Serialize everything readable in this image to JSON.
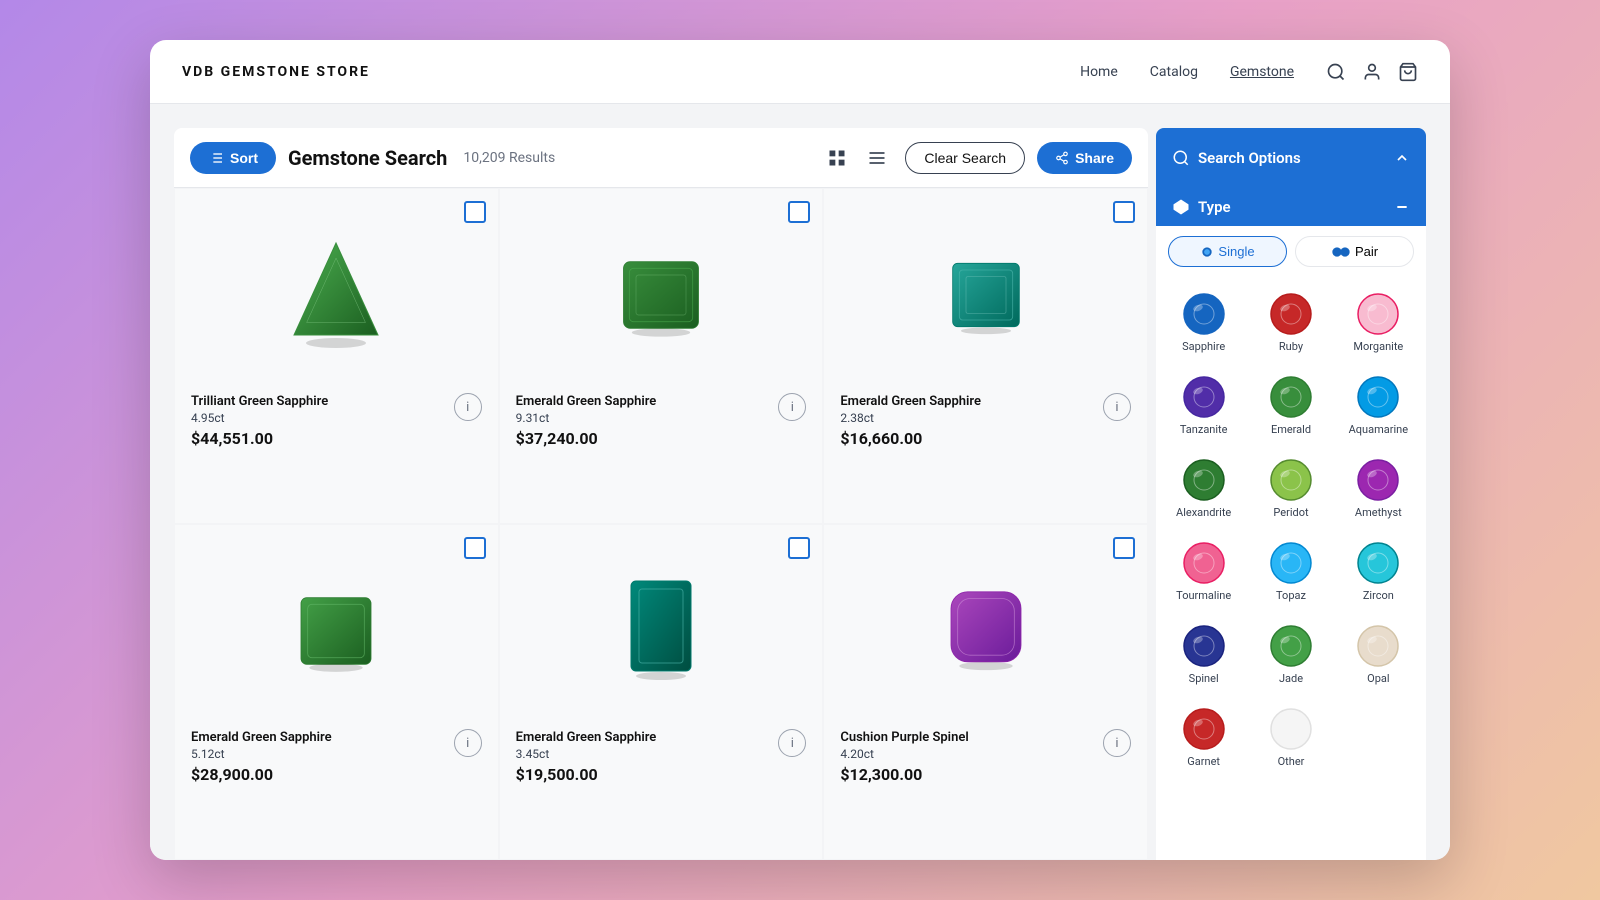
{
  "nav": {
    "logo": "VDB GEMSTONE STORE",
    "links": [
      {
        "label": "Home",
        "active": false
      },
      {
        "label": "Catalog",
        "active": false
      },
      {
        "label": "Gemstone",
        "active": true
      }
    ]
  },
  "toolbar": {
    "sort_label": "Sort",
    "search_title": "Gemstone Search",
    "result_count": "10,209 Results",
    "clear_label": "Clear Search",
    "share_label": "Share"
  },
  "products": [
    {
      "name": "Trilliant Green Sapphire",
      "carat": "4.95ct",
      "price": "$44,551.00",
      "shape": "trilliant",
      "color": "#2e7d32"
    },
    {
      "name": "Emerald Green Sapphire",
      "carat": "9.31ct",
      "price": "$37,240.00",
      "shape": "emerald",
      "color": "#1b5e20"
    },
    {
      "name": "Emerald Green Sapphire",
      "carat": "2.38ct",
      "price": "$16,660.00",
      "shape": "emerald",
      "color": "#00695c"
    },
    {
      "name": "Emerald Green Sapphire",
      "carat": "5.12ct",
      "price": "$28,900.00",
      "shape": "emerald2",
      "color": "#2e7d32"
    },
    {
      "name": "Emerald Green Sapphire",
      "carat": "3.45ct",
      "price": "$19,500.00",
      "shape": "emerald3",
      "color": "#00897b"
    },
    {
      "name": "Cushion Purple Spinel",
      "carat": "4.20ct",
      "price": "$12,300.00",
      "shape": "cushion",
      "color": "#7b1fa2"
    }
  ],
  "search_options": {
    "label": "Search Options",
    "type_section": "Type",
    "single_label": "Single",
    "pair_label": "Pair",
    "gems": [
      {
        "name": "Sapphire",
        "color": "#1565c0",
        "bg": "#1565c0"
      },
      {
        "name": "Ruby",
        "color": "#b71c1c",
        "bg": "#c62828"
      },
      {
        "name": "Morganite",
        "color": "#e91e63",
        "bg": "#f8bbd0"
      },
      {
        "name": "Tanzanite",
        "color": "#4527a0",
        "bg": "#512da8"
      },
      {
        "name": "Emerald",
        "color": "#2e7d32",
        "bg": "#388e3c"
      },
      {
        "name": "Aquamarine",
        "color": "#0277bd",
        "bg": "#039be5"
      },
      {
        "name": "Alexandrite",
        "color": "#1b5e20",
        "bg": "#2e7d32"
      },
      {
        "name": "Peridot",
        "color": "#558b2f",
        "bg": "#8bc34a"
      },
      {
        "name": "Amethyst",
        "color": "#7b1fa2",
        "bg": "#9c27b0"
      },
      {
        "name": "Tourmaline",
        "color": "#e91e63",
        "bg": "#f06292"
      },
      {
        "name": "Topaz",
        "color": "#0288d1",
        "bg": "#29b6f6"
      },
      {
        "name": "Zircon",
        "color": "#00838f",
        "bg": "#26c6da"
      },
      {
        "name": "Spinel",
        "color": "#1a237e",
        "bg": "#283593"
      },
      {
        "name": "Jade",
        "color": "#2e7d32",
        "bg": "#43a047"
      },
      {
        "name": "Opal",
        "color": "#d4c5a9",
        "bg": "#e8dccc"
      },
      {
        "name": "Garnet",
        "color": "#b71c1c",
        "bg": "#c62828"
      },
      {
        "name": "Other",
        "color": "#9e9e9e",
        "bg": ""
      }
    ]
  }
}
